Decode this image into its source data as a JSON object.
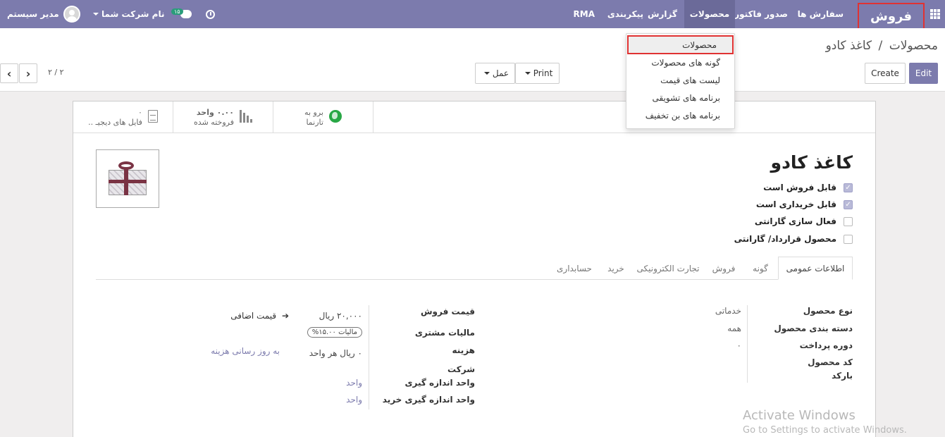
{
  "navbar": {
    "brand": "فروش",
    "menu": {
      "orders": "سفارش ها",
      "invoicing": "صدور فاکتور",
      "products": "محصولات",
      "reporting": "گزارش",
      "configuration": "پیکربندی",
      "rma": "RMA"
    },
    "company": "نام شرکت شما",
    "user": "مدیر سیستم",
    "messages_count": "۱۵"
  },
  "breadcrumb": {
    "parent": "محصولات",
    "separator": "/",
    "current": "کاغذ کادو"
  },
  "toolbar": {
    "edit": "Edit",
    "create": "Create",
    "print": "Print",
    "action": "عمل"
  },
  "pager": {
    "text": "۲ / ۲"
  },
  "dropdown": {
    "items": [
      "محصولات",
      "گونه های محصولات",
      "لیست های قیمت",
      "برنامه های تشویقی",
      "برنامه های بن تخفیف"
    ]
  },
  "stats": {
    "website_line1": "برو به",
    "website_line2": "تارنما",
    "sold_line1": "۰.۰۰ واحد",
    "sold_line2": "فروخته شده",
    "docs_line1": "۰",
    "docs_line2": "فایل های دیجیـ .."
  },
  "product": {
    "name": "کاغذ کادو",
    "checkboxes": [
      {
        "label": "قابل فروش است",
        "checked": true
      },
      {
        "label": "قابل خریداری است",
        "checked": true
      },
      {
        "label": "فعال سازی گارانتی",
        "checked": false
      },
      {
        "label": "محصول قرارداد/ گارانتی",
        "checked": false
      }
    ]
  },
  "tabs": [
    "اطلاعات عمومی",
    "گونه",
    "فروش",
    "تجارت الکترونیکی",
    "خرید",
    "حسابداری"
  ],
  "fields_right": {
    "product_type_label": "نوع محصول",
    "product_type_value": "خدماتی",
    "category_label": "دسته بندی محصول",
    "category_value": "همه",
    "payment_period_label": "دوره پرداخت",
    "payment_period_value": "۰",
    "code_label": "کد محصول",
    "barcode_label": "بارکد"
  },
  "fields_left": {
    "sale_price_label": "قیمت فروش",
    "sale_price_value": "۲۰,۰۰۰ ریال",
    "extra_price": "قیمت اضافی",
    "customer_tax_label": "مالیات مشتری",
    "customer_tax_value": "مالیات ۱۵.۰۰%",
    "cost_label": "هزینه",
    "cost_value": "۰ ریال هر واحد",
    "cost_update": "به روز رسانی هزینه",
    "company_label": "شرکت",
    "uom_label": "واحد اندازه گیری",
    "uom_value": "واحد",
    "purchase_uom_label": "واحد اندازه گیری خرید",
    "purchase_uom_value": "واحد"
  },
  "watermark": {
    "line1": "Activate Windows",
    "line2": "Go to Settings to activate Windows."
  },
  "colors": {
    "brand": "#7c7bad",
    "highlight": "#e03232"
  }
}
